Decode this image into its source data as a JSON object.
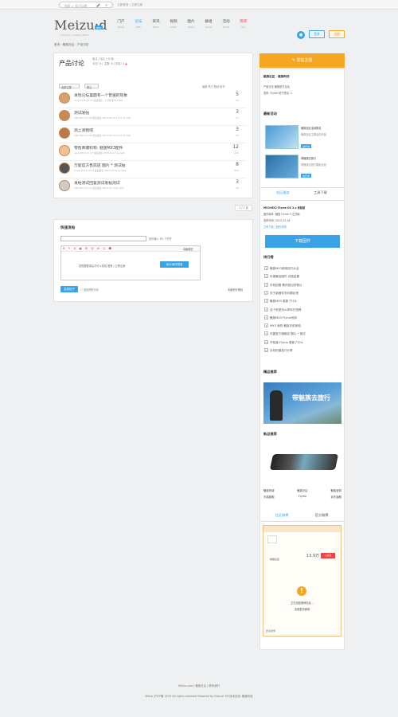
{
  "topbar": {
    "search_placeholder": "搜索 > 帖子标题",
    "links": "立即登录 | 立即注册"
  },
  "header": {
    "logo": "Meizu:d",
    "logo_badge": "BBS",
    "logo_sub": "simplify, vividize, refine",
    "nav": [
      {
        "label": "门户",
        "en": "Portal",
        "state": ""
      },
      {
        "label": "论坛",
        "en": "BBS",
        "state": "active"
      },
      {
        "label": "资讯",
        "en": "News",
        "state": ""
      },
      {
        "label": "视频",
        "en": "Video",
        "state": ""
      },
      {
        "label": "图片",
        "en": "Photo",
        "state": ""
      },
      {
        "label": "群组",
        "en": "Group",
        "state": ""
      },
      {
        "label": "活动",
        "en": "Event",
        "state": ""
      },
      {
        "label": "购买",
        "en": "Buy",
        "state": "hot"
      }
    ],
    "login_label": "登录",
    "register_label": "注册"
  },
  "breadcrumb": "首页 › 魅族社区 › 产品讨论",
  "forum": {
    "title": "产品讨论",
    "stats_line1": "版主: 社区 | 分 版",
    "today_label": "今日:",
    "today_value": "0",
    "topics_label": "主题:",
    "topics_value": "6",
    "rank_label": "排名:",
    "rank_value": "1",
    "filter_select": "全部主题",
    "sort_select": "默认",
    "right_tabs": "最新  热门  热帖  精华",
    "threads": [
      {
        "title": "发现论坛里面有一个普遍的现象",
        "meta": "ceyp  2013-12-19  最后发表 : 1 分钟 前 by test",
        "replies": "5",
        "views": "45"
      },
      {
        "title": "测试发帖",
        "meta": "test  2013-12-18  最后发表 2013-12-18 11:32 by test",
        "replies": "3",
        "views": "27"
      },
      {
        "title": "测上测我吧",
        "meta": "test  2013-12-18  最后发表 2013-12-18 11:30 by test",
        "replies": "3",
        "views": "40"
      },
      {
        "title": "零售商爆料称: 魅族MX3配件",
        "meta": "ceyp  2013-12-17  最后发表 2013-12-17 by test",
        "replies": "12",
        "views": "340"
      },
      {
        "title": "万能官方售前店  图片 * 测试帖",
        "meta": "meyp  2013-12-15  最后发表 2013-12-15 by test",
        "replies": "8",
        "views": "229"
      },
      {
        "title": "发帖测试回复测试发帖测试",
        "meta": "test  2013-12-14  最后发表 2013-12-14 by test",
        "replies": "3",
        "views": "33"
      }
    ],
    "pager": "1 / 1 页"
  },
  "quick_post": {
    "title": "快速发帖",
    "char_hint": "还可输入 80 个字符",
    "login_hint": "您需要登录后才可以发帖  登录  |  立即注册",
    "qq_button": "用QQ帐号登录",
    "advanced": "高级模式",
    "submit": "发表帖子",
    "checkbox": "发帖同时分享",
    "rules": "本版积分规则"
  },
  "sidebar": {
    "post_button": "发帖主题",
    "info_title": "魅族社区 · 魅族科技",
    "info_rows": [
      "产品讨论  魅族官方论坛",
      "发布: Flyme  帖子排名: 1"
    ],
    "news_title": "最新活动",
    "news_items": [
      {
        "title": "魅族社区活动报名",
        "desc": "魅族社区主题活动开始",
        "tag": "进行中"
      },
      {
        "title": "带魅族去旅行",
        "desc": "带魅族去旅行摄影比赛",
        "tag": "进行中"
      }
    ],
    "tab_a": "社区服务",
    "tab_b": "工具下载",
    "flyme_line": "MX3/MX2 Flyme OS 3.x 体验版",
    "flyme_desc": "固件版本: 魅族 Flyme 3 正式版",
    "flyme_desc2": "发布时间: 2013-12-18",
    "flyme_links": "立即下载  |  固件说明",
    "download": "下载固件",
    "rank_title": "排行榜",
    "rank_items": [
      "魅族MX3使用技巧大全",
      "年度最佳固件  评选结果",
      "手机拍照 教你拍出好照片",
      "关于新固件的问题反馈",
      "魅族MX3 更新了什么",
      "这个机型怎么样你们觉得",
      "魅族MX3 Flyme测评",
      "MX3 我的 魅族手机体验",
      "天翼官方旗舰店 图片 * 测试",
      "不知道 Flyme 更新了什么",
      "手机拍摄技巧分享"
    ],
    "ad_title": "精品推荐",
    "ad_text": "带魅族去旅行",
    "new_prod_title": "新品推荐",
    "links_rows": [
      [
        "魅族商城",
        "魅族社区",
        "魅族官网"
      ],
      [
        "天猫旗舰",
        "Flyme",
        "京东旗舰"
      ]
    ],
    "weibo_tab_a": "社区微博",
    "weibo_tab_b": "官方微博",
    "weibo_name": "魅族社区",
    "weibo_count": "13.9万",
    "weibo_follow": "+关注",
    "weibo_msg": "正在加载微博信息...",
    "weibo_link": "查看更多微博",
    "weibo_footer": "更多微博"
  },
  "footer": {
    "links": "Meizu.com  |  魅族社区  |  联系我们",
    "copyright": "Meizu  沪ICP备 2013 All rights reserved  Powered by Discuz! X3  技术支持: 魅族科技"
  },
  "colors": {
    "accent": "#3aa3e8",
    "orange": "#f5a623",
    "red": "#e44444",
    "bg": "#eef0f1"
  }
}
